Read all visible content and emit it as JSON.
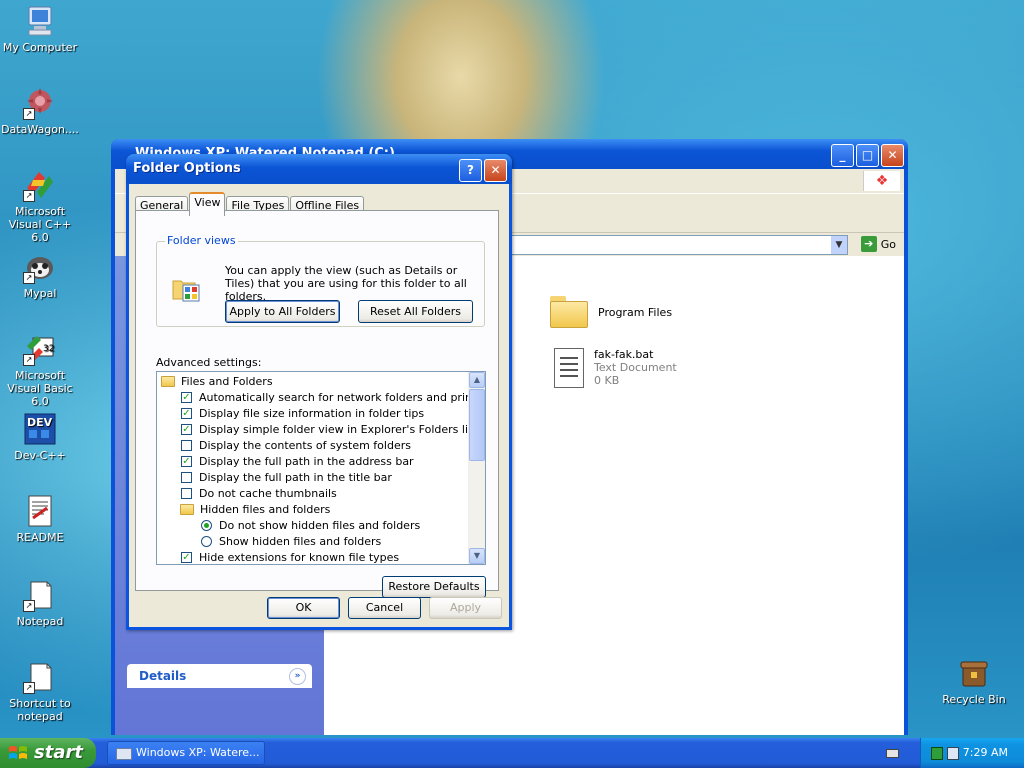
{
  "desktop": {
    "icons": [
      {
        "label": "My Computer"
      },
      {
        "label": "DataWagon...."
      },
      {
        "label": "Microsoft Visual C++ 6.0"
      },
      {
        "label": "Mypal"
      },
      {
        "label": "Microsoft Visual Basic 6.0"
      },
      {
        "label": "Dev-C++"
      },
      {
        "label": "README"
      },
      {
        "label": "Notepad"
      },
      {
        "label": "Shortcut to notepad"
      },
      {
        "label": "Recycle Bin"
      }
    ]
  },
  "explorer": {
    "title": "Windows XP: Watered Notepad (C:)",
    "address_go": "Go",
    "details_label": "Details",
    "files": [
      {
        "name": "Program Files",
        "type": "folder"
      },
      {
        "name": "fak-fak.bat",
        "meta1": "Text Document",
        "meta2": "0 KB",
        "type": "text"
      }
    ]
  },
  "dialog": {
    "title": "Folder Options",
    "tabs": [
      "General",
      "View",
      "File Types",
      "Offline Files"
    ],
    "active_tab": "View",
    "folder_views": {
      "group_title": "Folder views",
      "description": "You can apply the view (such as Details or Tiles) that you are using for this folder to all folders.",
      "apply_all": "Apply to All Folders",
      "reset_all": "Reset All Folders"
    },
    "advanced_label": "Advanced settings:",
    "advanced_items": [
      {
        "kind": "folder",
        "label": "Files and Folders",
        "indent": 0
      },
      {
        "kind": "check",
        "checked": true,
        "label": "Automatically search for network folders and printers",
        "indent": 1
      },
      {
        "kind": "check",
        "checked": true,
        "label": "Display file size information in folder tips",
        "indent": 1
      },
      {
        "kind": "check",
        "checked": true,
        "label": "Display simple folder view in Explorer's Folders list",
        "indent": 1
      },
      {
        "kind": "check",
        "checked": false,
        "label": "Display the contents of system folders",
        "indent": 1
      },
      {
        "kind": "check",
        "checked": true,
        "label": "Display the full path in the address bar",
        "indent": 1
      },
      {
        "kind": "check",
        "checked": false,
        "label": "Display the full path in the title bar",
        "indent": 1
      },
      {
        "kind": "check",
        "checked": false,
        "label": "Do not cache thumbnails",
        "indent": 1
      },
      {
        "kind": "folder",
        "label": "Hidden files and folders",
        "indent": 1
      },
      {
        "kind": "radio",
        "checked": true,
        "label": "Do not show hidden files and folders",
        "indent": 2
      },
      {
        "kind": "radio",
        "checked": false,
        "label": "Show hidden files and folders",
        "indent": 2
      },
      {
        "kind": "check",
        "checked": true,
        "label": "Hide extensions for known file types",
        "indent": 1
      }
    ],
    "restore_defaults": "Restore Defaults",
    "ok": "OK",
    "cancel": "Cancel",
    "apply": "Apply"
  },
  "taskbar": {
    "start": "start",
    "task_label": "Windows XP: Watere...",
    "clock": "7:29 AM"
  },
  "colors": {
    "xp_blue": "#0a54e0",
    "start_green": "#3a9a3a",
    "check_green": "#21a121",
    "group_title_blue": "#0046d5"
  }
}
